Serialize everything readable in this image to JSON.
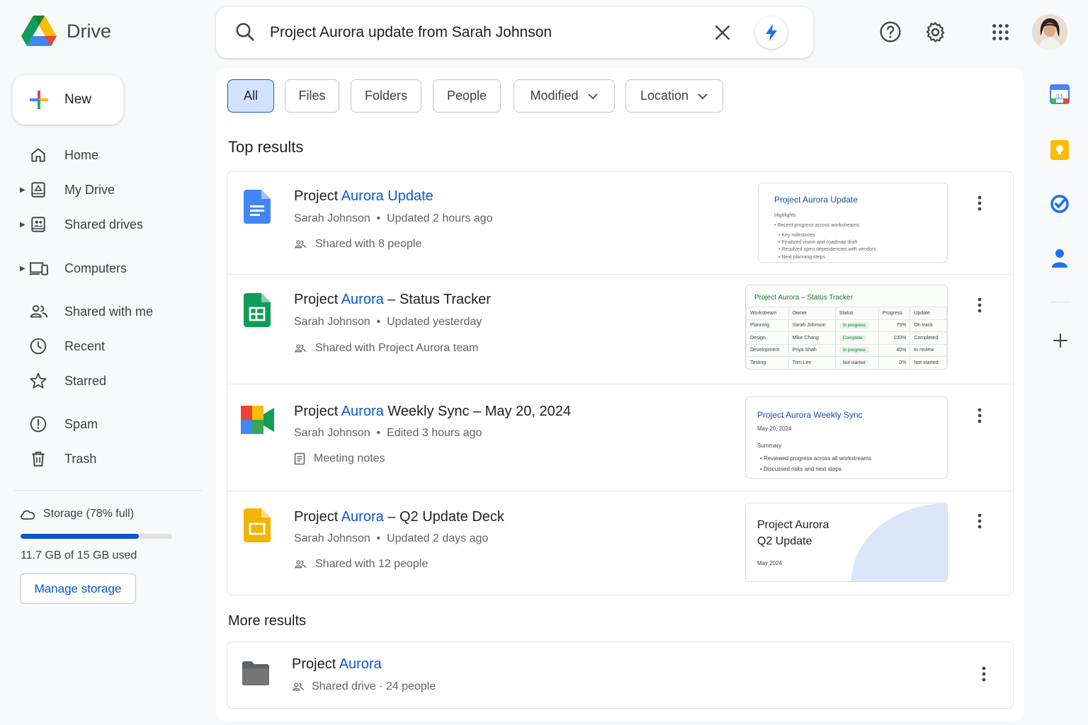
{
  "app": {
    "name": "Drive"
  },
  "search": {
    "query": "Project Aurora update from Sarah Johnson"
  },
  "sidebar": {
    "new_label": "New",
    "items": [
      {
        "label": "Home",
        "icon": "home-icon"
      },
      {
        "label": "My Drive",
        "icon": "my-drive-icon"
      },
      {
        "label": "Shared drives",
        "icon": "shared-drives-icon"
      },
      {
        "label": "Computers",
        "icon": "computers-icon"
      },
      {
        "label": "Shared with me",
        "icon": "shared-with-me-icon"
      },
      {
        "label": "Recent",
        "icon": "clock-icon"
      },
      {
        "label": "Starred",
        "icon": "star-icon"
      },
      {
        "label": "Spam",
        "icon": "spam-icon"
      },
      {
        "label": "Trash",
        "icon": "trash-icon"
      }
    ],
    "storage": {
      "label": "Storage (78% full)",
      "fraction": 0.78,
      "used_text": "11.7 GB of 15 GB used",
      "manage_label": "Manage storage"
    }
  },
  "filters": [
    "All",
    "Files",
    "Folders",
    "People",
    "Modified",
    "Location"
  ],
  "sections": {
    "top": "Top results",
    "more": "More results"
  },
  "results": [
    {
      "title_prefix": "Project ",
      "title_highlight": "Aurora Update",
      "title_suffix": "",
      "owner": "Sarah Johnson",
      "dot": "•",
      "time": "Updated 2 hours ago",
      "detail": "Shared with 8 people",
      "thumb": {
        "title": "Project Aurora Update",
        "lines": [
          "Highlights",
          "• Recent progress across workstreams",
          "• Key milestones",
          "• Finalized vision and roadmap draft",
          "• Resolved open dependencies with vendors",
          "• Next planning steps"
        ]
      }
    },
    {
      "title_prefix": "Project ",
      "title_highlight": "Aurora",
      "title_suffix": " – Status Tracker",
      "owner": "Sarah Johnson",
      "dot": "•",
      "time": "Updated yesterday",
      "detail": "Shared with Project Aurora team",
      "thumb": {
        "title": "Project Aurora – Status Tracker",
        "headers": [
          "Workstream",
          "Owner",
          "Status",
          "Progress",
          "Update"
        ],
        "rows": [
          [
            "Planning",
            "Sarah Johnson",
            "In progress",
            "75%",
            "On track"
          ],
          [
            "Design",
            "Mike Chang",
            "Complete",
            "100%",
            "Completed"
          ],
          [
            "Development",
            "Priya Shah",
            "In progress",
            "40%",
            "In review"
          ],
          [
            "Testing",
            "Tom Lee",
            "Not started",
            "0%",
            "Not started"
          ]
        ]
      }
    },
    {
      "title_prefix": "Project ",
      "title_highlight": "Aurora",
      "title_suffix": " Weekly Sync – May 20, 2024",
      "owner": "Sarah Johnson",
      "dot": "•",
      "time": "Edited 3 hours ago",
      "detail": "Meeting notes",
      "thumb": {
        "title": "Project Aurora Weekly Sync",
        "date": "May 20, 2024",
        "heading": "Summary",
        "bullets": [
          "• Reviewed progress across all workstreams",
          "• Discussed risks and next steps"
        ]
      }
    },
    {
      "title_prefix": "Project ",
      "title_highlight": "Aurora",
      "title_suffix": " – Q2 Update Deck",
      "owner": "Sarah Johnson",
      "dot": "•",
      "time": "Updated 2 days ago",
      "detail": "Shared with 12 people",
      "thumb": {
        "line1": "Project Aurora",
        "line2": "Q2 Update",
        "date": "May 2024"
      }
    }
  ],
  "more_results": [
    {
      "title_prefix": "Project ",
      "title_highlight": "Aurora",
      "detail": "Shared drive · 24 people"
    }
  ],
  "colors": {
    "accent": "#0b57d0",
    "docs": "#4285f4",
    "sheets": "#0f9d58",
    "slides": "#f4b400"
  }
}
